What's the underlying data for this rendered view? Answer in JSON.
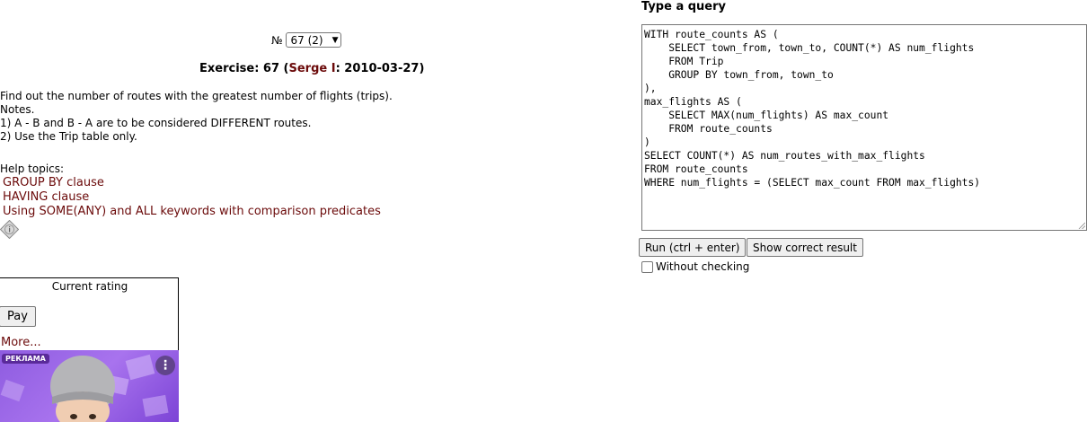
{
  "exercise_selector": {
    "prefix": "№",
    "value": "67 (2)"
  },
  "exercise": {
    "label": "Exercise: 67 (",
    "author": "Serge I",
    "date_part": ": 2010-03-27)"
  },
  "task_lines": [
    "Find out the number of routes with the greatest number of flights (trips).",
    "Notes.",
    "1) A - B and B - A are to be considered DIFFERENT routes.",
    "2) Use the Trip table only."
  ],
  "help": {
    "title": "Help topics:",
    "links": [
      "GROUP BY clause",
      "HAVING clause",
      "Using SOME(ANY) and ALL keywords with comparison predicates"
    ]
  },
  "rating": {
    "title": "Current rating",
    "pay_label": "Pay",
    "more_label": "More..."
  },
  "ad": {
    "badge": "РЕКЛАМА"
  },
  "query": {
    "label": "Type a query",
    "text": "WITH route_counts AS (\n    SELECT town_from, town_to, COUNT(*) AS num_flights\n    FROM Trip\n    GROUP BY town_from, town_to\n),\nmax_flights AS (\n    SELECT MAX(num_flights) AS max_count\n    FROM route_counts\n)\nSELECT COUNT(*) AS num_routes_with_max_flights\nFROM route_counts\nWHERE num_flights = (SELECT max_count FROM max_flights)"
  },
  "buttons": {
    "run_label": "Run (ctrl + enter)",
    "show_label": "Show correct result"
  },
  "without_checking_label": "Without checking",
  "colors": {
    "link": "#6b0a0a",
    "ad_background": "#8e5ce0"
  }
}
